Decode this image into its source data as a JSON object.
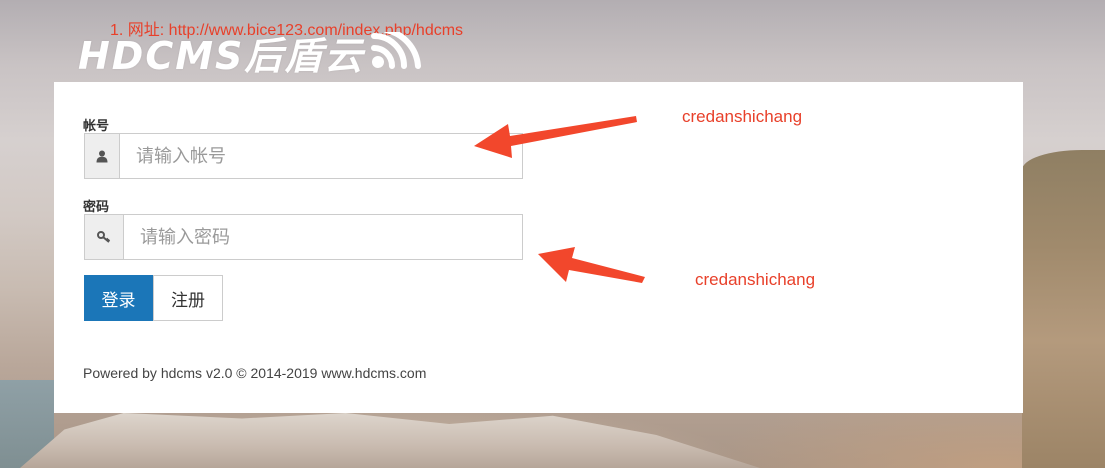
{
  "annotation": {
    "url_note": "1. 网址: http://www.bice123.com/index.php/hdcms",
    "credential_notes": [
      "credanshichang",
      "credanshichang"
    ],
    "color": "#e8402a"
  },
  "brand": {
    "logo_text": "HDCMS后盾云",
    "logo_icon": "signal-waves-icon"
  },
  "login_form": {
    "username": {
      "label": "帐号",
      "placeholder": "请输入帐号",
      "value": "",
      "icon": "user-icon"
    },
    "password": {
      "label": "密码",
      "placeholder": "请输入密码",
      "value": "",
      "icon": "key-icon"
    },
    "buttons": {
      "login": "登录",
      "register": "注册"
    },
    "footer": "Powered by hdcms v2.0 © 2014-2019 www.hdcms.com"
  },
  "colors": {
    "primary_button": "#1b76b8",
    "annotation": "#e8402a"
  }
}
